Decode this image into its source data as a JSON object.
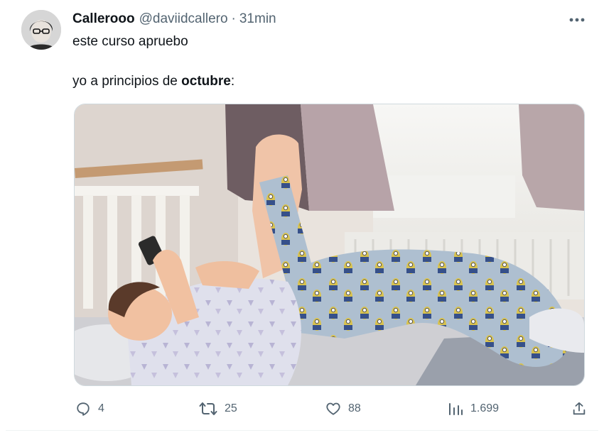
{
  "tweet": {
    "display_name": "Callerooo",
    "handle": "@daviidcallero",
    "separator": "·",
    "time": "31min",
    "text_line1": "este curso apruebo",
    "text_line2_prefix": "yo a principios de ",
    "text_line2_bold": "octubre",
    "text_line2_suffix": ":"
  },
  "actions": {
    "replies": "4",
    "retweets": "25",
    "likes": "88",
    "views": "1.699"
  },
  "icons": {
    "more": "more-horizontal-icon",
    "reply": "reply-icon",
    "retweet": "retweet-icon",
    "like": "heart-icon",
    "views": "views-chart-icon",
    "share": "share-icon"
  },
  "colors": {
    "text_primary": "#0f1419",
    "text_secondary": "#536471",
    "border": "#cfd9de"
  }
}
